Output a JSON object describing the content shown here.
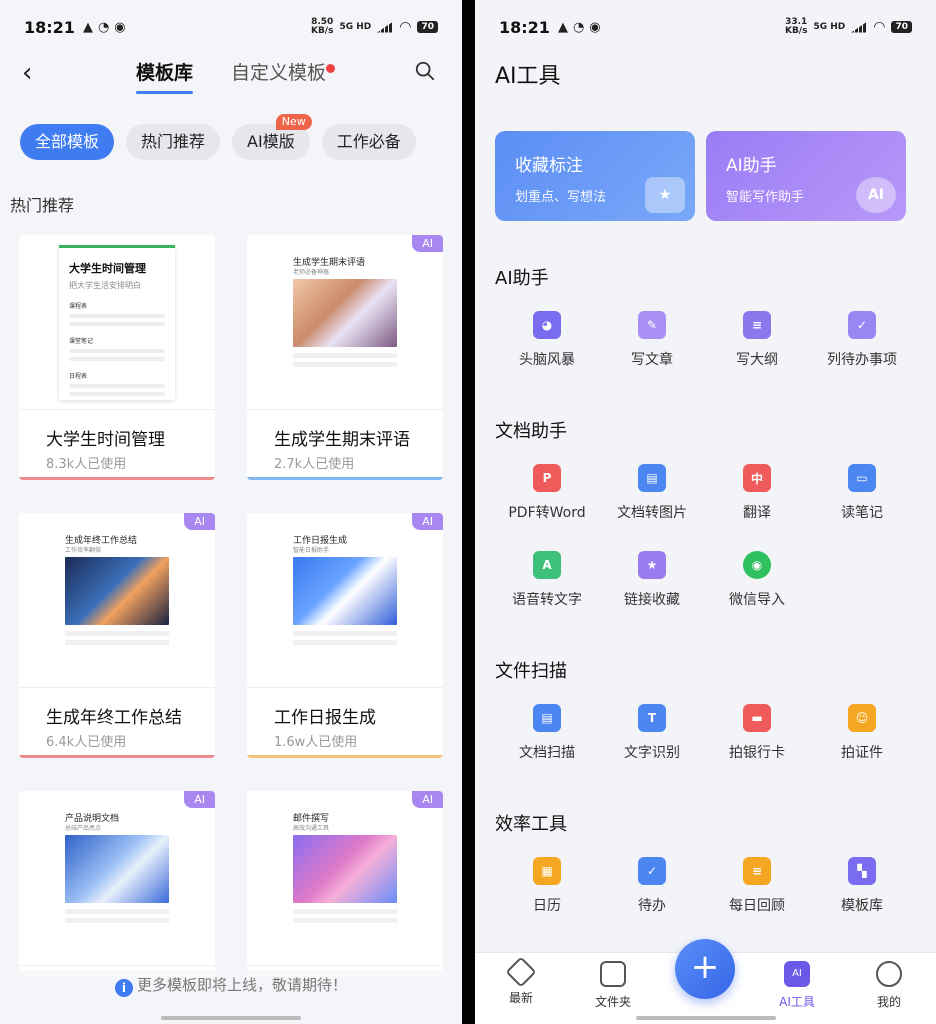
{
  "left": {
    "status": {
      "time": "18:21",
      "speed": "8.50",
      "speed_unit": "KB/s",
      "net": "5G HD",
      "battery": "70"
    },
    "nav": {
      "back": "‹",
      "tab_active": "模板库",
      "tab_other": "自定义模板"
    },
    "chips": [
      {
        "label": "全部模板"
      },
      {
        "label": "热门推荐"
      },
      {
        "label": "AI模版",
        "badge": "New"
      },
      {
        "label": "工作必备"
      }
    ],
    "section_title": "热门推荐",
    "cards": [
      {
        "title": "大学生时间管理",
        "meta": "8.3k人已使用",
        "preview_title": "大学生时间管理",
        "preview_sub": "把大学生活安排明白",
        "preview_lines": [
          "课程表",
          "课堂笔记",
          "日程表"
        ],
        "underline": "#f08a8a"
      },
      {
        "title": "生成学生期末评语",
        "meta": "2.7k人已使用",
        "preview_title": "生成学生期末评语",
        "preview_sub": "老师必备神器",
        "ai": "AI",
        "underline": "#7fb8f0"
      },
      {
        "title": "生成年终工作总结",
        "meta": "6.4k人已使用",
        "preview_title": "生成年终工作总结",
        "preview_sub": "工作效率翻倍",
        "ai": "AI",
        "underline": "#f08a8a"
      },
      {
        "title": "工作日报生成",
        "meta": "1.6w人已使用",
        "preview_title": "工作日报生成",
        "preview_sub": "智能日报助手",
        "ai": "AI",
        "underline": "#f5c07a"
      },
      {
        "preview_title": "产品说明文档",
        "preview_sub": "总结产品亮点",
        "ai": "AI"
      },
      {
        "preview_title": "邮件撰写",
        "preview_sub": "高效沟通工具",
        "ai": "AI"
      }
    ],
    "footnote": "更多模板即将上线，敬请期待！"
  },
  "right": {
    "status": {
      "time": "18:21",
      "speed": "33.1",
      "speed_unit": "KB/s",
      "net": "5G HD",
      "battery": "70"
    },
    "title": "AI工具",
    "big_cards": [
      {
        "title": "收藏标注",
        "sub": "划重点、写想法",
        "deco": "★"
      },
      {
        "title": "AI助手",
        "sub": "智能写作助手",
        "deco": "AI"
      }
    ],
    "groups": [
      {
        "title": "AI助手",
        "tools": [
          {
            "label": "头脑风暴",
            "icon": "brain-icon",
            "color": "#7a6cf0"
          },
          {
            "label": "写文章",
            "icon": "pen-icon",
            "color": "#a890f5"
          },
          {
            "label": "写大纲",
            "icon": "outline-icon",
            "color": "#8a78ee"
          },
          {
            "label": "列待办事项",
            "icon": "todo-calendar-icon",
            "color": "#9a86f2"
          }
        ]
      },
      {
        "title": "文档助手",
        "tools": [
          {
            "label": "PDF转Word",
            "icon": "pdf-icon",
            "color": "#ef5b5b"
          },
          {
            "label": "文档转图片",
            "icon": "doc-image-icon",
            "color": "#4c86f0"
          },
          {
            "label": "翻译",
            "icon": "translate-icon",
            "color": "#ef5b5b"
          },
          {
            "label": "读笔记",
            "icon": "read-notes-icon",
            "color": "#4c86f0"
          },
          {
            "label": "语音转文字",
            "icon": "voice-text-icon",
            "color": "#3cc07a"
          },
          {
            "label": "链接收藏",
            "icon": "star-icon",
            "color": "#9a7cf0"
          },
          {
            "label": "微信导入",
            "icon": "wechat-icon",
            "color": "#2fc060"
          }
        ]
      },
      {
        "title": "文件扫描",
        "tools": [
          {
            "label": "文档扫描",
            "icon": "scan-doc-icon",
            "color": "#4c86f0"
          },
          {
            "label": "文字识别",
            "icon": "ocr-icon",
            "color": "#4c86f0"
          },
          {
            "label": "拍银行卡",
            "icon": "bank-card-icon",
            "color": "#ef5b5b"
          },
          {
            "label": "拍证件",
            "icon": "id-card-icon",
            "color": "#f5a623"
          }
        ]
      },
      {
        "title": "效率工具",
        "tools": [
          {
            "label": "日历",
            "icon": "calendar-icon",
            "color": "#f5a623"
          },
          {
            "label": "待办",
            "icon": "checkbox-icon",
            "color": "#4c86f0"
          },
          {
            "label": "每日回顾",
            "icon": "review-icon",
            "color": "#f5a623"
          },
          {
            "label": "模板库",
            "icon": "template-icon",
            "color": "#7a6cf0"
          }
        ]
      }
    ],
    "tabbar": [
      {
        "label": "最新",
        "icon": "tag-icon"
      },
      {
        "label": "文件夹",
        "icon": "folder-icon"
      },
      {
        "label": "AI工具",
        "icon": "ai-icon",
        "active": true
      },
      {
        "label": "我的",
        "icon": "smile-icon"
      }
    ],
    "fab": "+"
  }
}
